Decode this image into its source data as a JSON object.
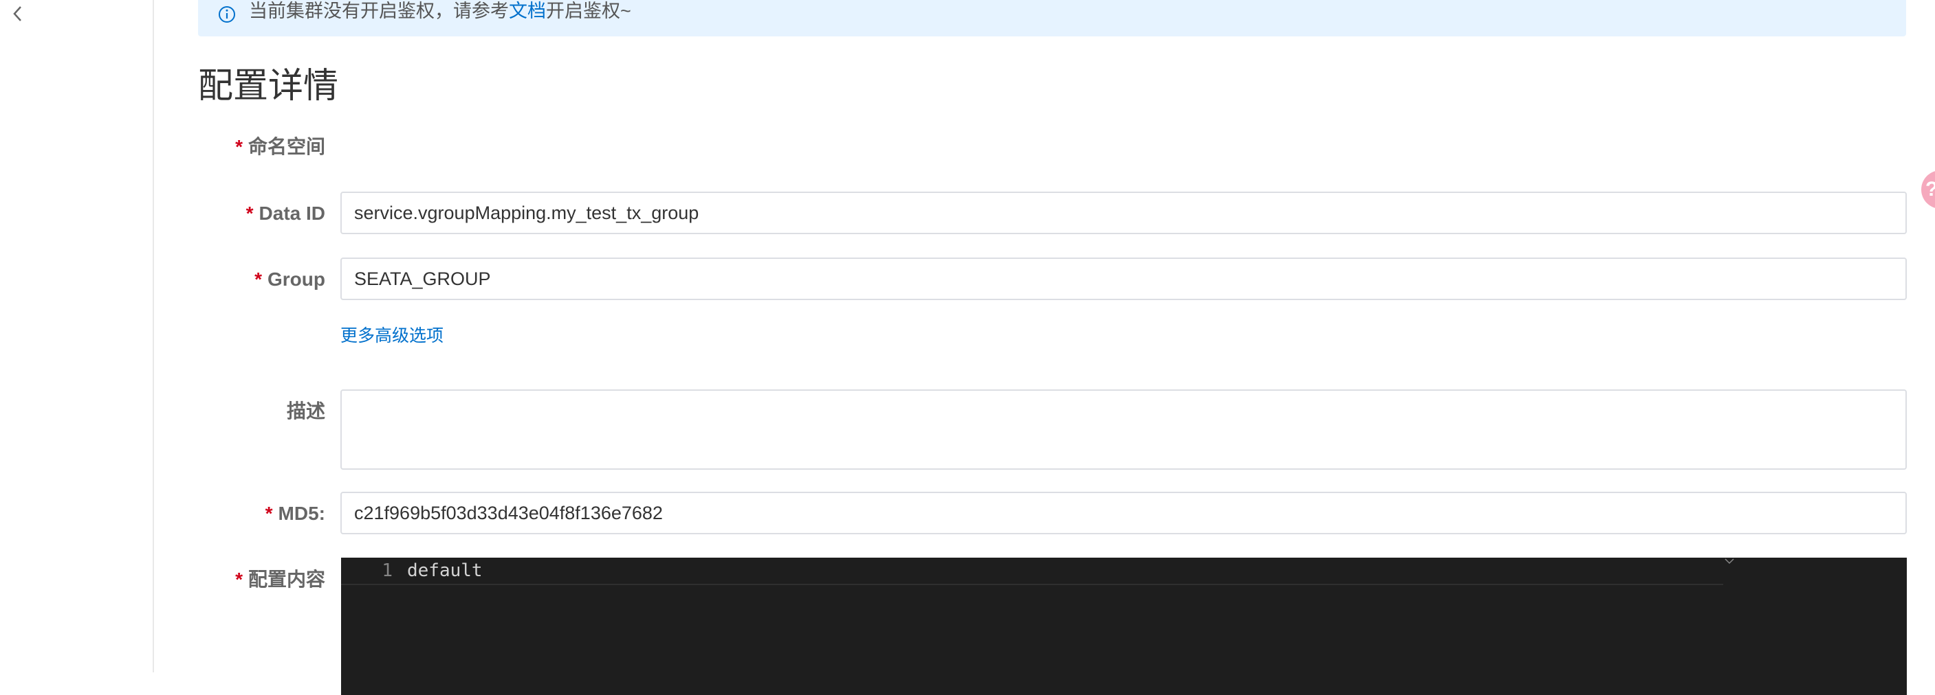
{
  "notice": {
    "text_before": "当前集群没有开启鉴权，请参考",
    "link": "文档",
    "text_after": "开启鉴权~"
  },
  "page": {
    "title": "配置详情"
  },
  "form": {
    "required_mark": "*",
    "namespace": {
      "label": "命名空间"
    },
    "data_id": {
      "label": "Data ID",
      "value": "service.vgroupMapping.my_test_tx_group"
    },
    "group": {
      "label": "Group",
      "value": "SEATA_GROUP"
    },
    "advanced_link": "更多高级选项",
    "description": {
      "label": "描述",
      "value": ""
    },
    "md5": {
      "label": "MD5:",
      "value": "c21f969b5f03d33d43e04f8f136e7682"
    },
    "content": {
      "label": "配置内容"
    }
  },
  "editor": {
    "lines": [
      {
        "number": "1",
        "code": "default"
      }
    ]
  },
  "icons": {
    "collapse": "chevron-left-icon",
    "notice": "info-circle-icon"
  },
  "colors": {
    "accent": "#0070cc",
    "required": "#d0021b",
    "notice_bg": "#e6f3ff",
    "editor_bg": "#1e1e1e"
  }
}
